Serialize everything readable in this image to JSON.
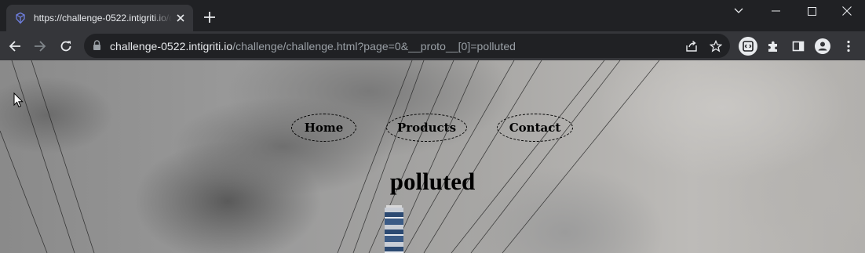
{
  "browser": {
    "tab": {
      "title": "https://challenge-0522.intigriti.io/challenge/challenge.html?page=0&__proto__[0]=polluted",
      "favicon": "intigriti-logo-icon"
    },
    "window_controls": [
      "chevron-down-icon",
      "minimize-icon",
      "maximize-icon",
      "close-icon"
    ],
    "toolbar": {
      "url_host": "challenge-0522.intigriti.io",
      "url_path": "/challenge/challenge.html?page=0&__proto__[0]=polluted",
      "icons": [
        "back-arrow-icon",
        "forward-arrow-icon",
        "reload-icon",
        "lock-icon",
        "share-icon",
        "star-icon",
        "extension-badge-icon",
        "puzzle-extensions-icon",
        "side-panel-icon",
        "profile-icon",
        "kebab-menu-icon"
      ]
    },
    "colors": {
      "frame": "#202124",
      "toolbar": "#35363a",
      "text": "#e8eaed",
      "muted": "#9aa0a6"
    }
  },
  "page": {
    "nav": [
      {
        "label": "Home"
      },
      {
        "label": "Products"
      },
      {
        "label": "Contact"
      }
    ],
    "heading": "polluted",
    "background": "industrial-smokestack-photo"
  }
}
